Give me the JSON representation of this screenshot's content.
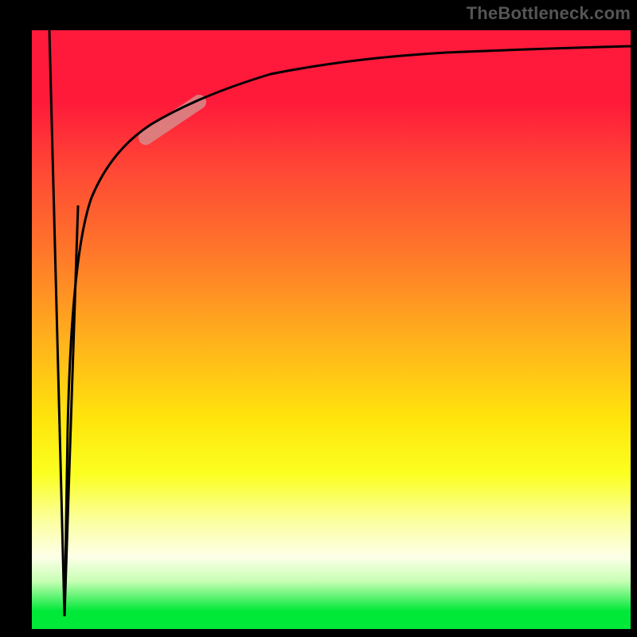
{
  "watermark": {
    "text": "TheBottleneck.com"
  },
  "chart_data": {
    "type": "line",
    "title": "",
    "xlabel": "",
    "ylabel": "",
    "xlim": [
      0,
      100
    ],
    "ylim": [
      0,
      100
    ],
    "grid": false,
    "legend": false,
    "background_gradient": {
      "direction": "vertical",
      "stops": [
        {
          "position": 0,
          "color": "#ff1a3c"
        },
        {
          "position": 40,
          "color": "#ff8a20"
        },
        {
          "position": 70,
          "color": "#ffe800"
        },
        {
          "position": 88,
          "color": "#fbffe0"
        },
        {
          "position": 100,
          "color": "#00e838"
        }
      ]
    },
    "series": [
      {
        "name": "spike-down",
        "color": "#000000",
        "x": [
          3.0,
          5.5,
          8.0
        ],
        "y": [
          100,
          2,
          70
        ]
      },
      {
        "name": "rising-curve",
        "color": "#000000",
        "x": [
          5.5,
          6,
          7,
          8,
          10,
          12,
          15,
          18,
          22,
          26,
          32,
          40,
          50,
          60,
          70,
          80,
          90,
          100
        ],
        "y": [
          2,
          30,
          50,
          62,
          72,
          78,
          82,
          85,
          88,
          90,
          92,
          93.5,
          94.5,
          95.3,
          95.8,
          96.2,
          96.5,
          96.8
        ]
      },
      {
        "name": "highlight-segment",
        "color": "#d78a8a",
        "stroke_width": 10,
        "x": [
          19,
          28
        ],
        "y": [
          82,
          88
        ]
      }
    ]
  }
}
